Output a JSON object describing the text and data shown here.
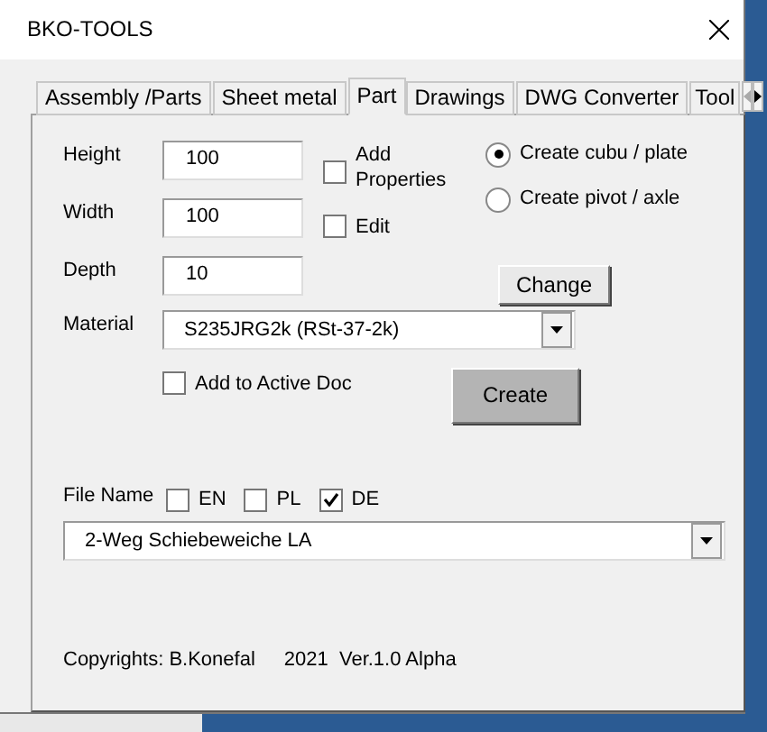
{
  "window": {
    "title": "BKO-TOOLS"
  },
  "tabs": [
    {
      "label": "Assembly /Parts",
      "selected": false
    },
    {
      "label": "Sheet metal",
      "selected": false
    },
    {
      "label": "Part",
      "selected": true
    },
    {
      "label": "Drawings",
      "selected": false
    },
    {
      "label": "DWG Converter",
      "selected": false
    },
    {
      "label": "Tool",
      "selected": false
    }
  ],
  "fields": [
    {
      "label": "Height",
      "value": "100"
    },
    {
      "label": "Width",
      "value": "100"
    },
    {
      "label": "Depth",
      "value": "10"
    }
  ],
  "options": [
    {
      "label": "Add Properties",
      "checked": false
    },
    {
      "label": "Edit",
      "checked": false
    }
  ],
  "shape": [
    {
      "label": "Create cubu / plate",
      "selected": true
    },
    {
      "label": "Create pivot / axle",
      "selected": false
    }
  ],
  "change_button": "Change",
  "material": {
    "label": "Material",
    "value": "S235JRG2k (RSt-37-2k)"
  },
  "add_to_active_doc": {
    "label": "Add to Active Doc",
    "checked": false
  },
  "create_button": "Create",
  "file_name": {
    "label": "File Name",
    "languages": [
      {
        "label": "EN",
        "checked": false
      },
      {
        "label": "PL",
        "checked": false
      },
      {
        "label": "DE",
        "checked": true
      }
    ],
    "value": "2-Weg Schiebeweiche LA"
  },
  "footer": {
    "author": "Copyrights: B.Konefal",
    "version": "2021  Ver.1.0 Alpha"
  }
}
